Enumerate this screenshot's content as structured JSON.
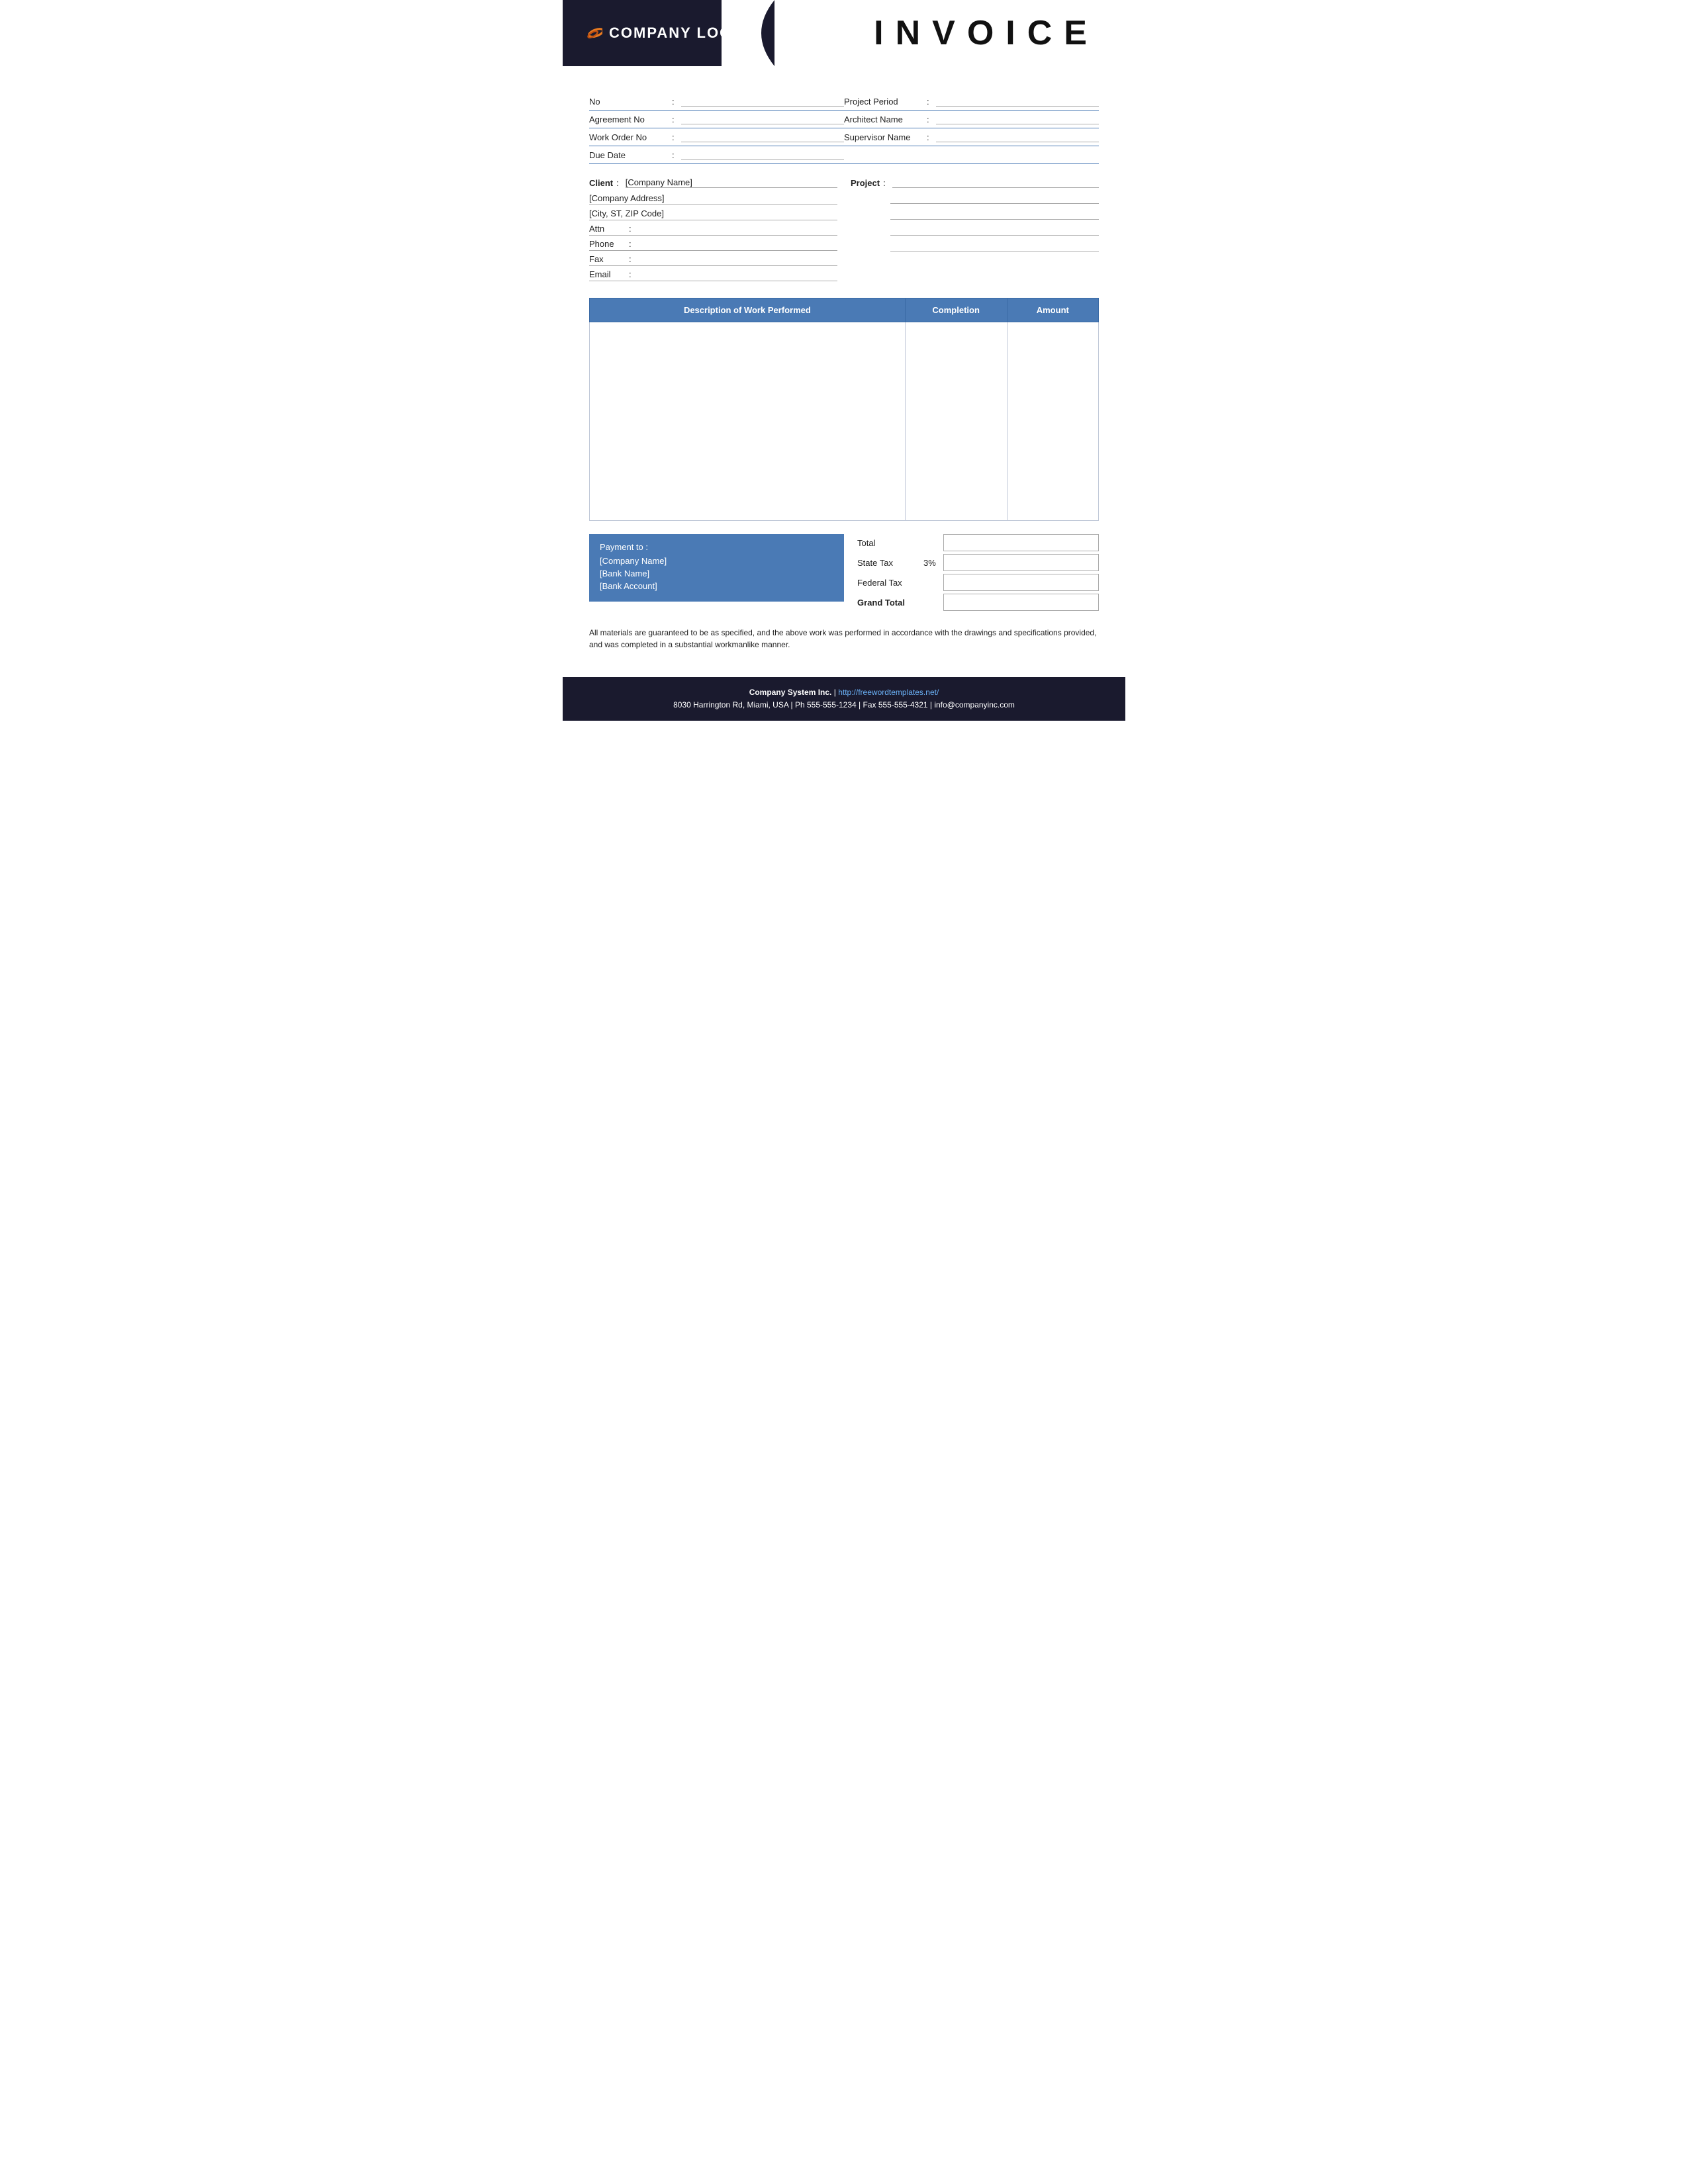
{
  "header": {
    "logo_text": "COMPANY LOGO",
    "invoice_title": "INVOICE"
  },
  "fields": {
    "rows": [
      {
        "left_label": "No",
        "left_colon": ":",
        "right_label": "Project Period",
        "right_colon": ":"
      },
      {
        "left_label": "Agreement No",
        "left_colon": ":",
        "right_label": "Architect Name",
        "right_colon": ":"
      },
      {
        "left_label": "Work Order No",
        "left_colon": ":",
        "right_label": "Supervisor Name",
        "right_colon": ":"
      },
      {
        "left_label": "Due Date",
        "left_colon": ":",
        "right_label": "",
        "right_colon": ""
      }
    ]
  },
  "client": {
    "label": "Client",
    "colon": ":",
    "name_placeholder": "[Company Name]",
    "address_placeholder": "[Company Address]",
    "city_placeholder": "[City, ST, ZIP Code]",
    "attn_label": "Attn",
    "attn_colon": ":",
    "phone_label": "Phone",
    "phone_colon": ":",
    "fax_label": "Fax",
    "fax_colon": ":",
    "email_label": "Email",
    "email_colon": ":"
  },
  "project": {
    "label": "Project",
    "colon": ":"
  },
  "table": {
    "headers": {
      "description": "Description of Work Performed",
      "completion": "Completion",
      "amount": "Amount"
    }
  },
  "payment": {
    "title": "Payment to :",
    "company": "[Company Name]",
    "bank": "[Bank Name]",
    "account": "[Bank Account]"
  },
  "totals": {
    "total_label": "Total",
    "state_tax_label": "State Tax",
    "state_tax_percent": "3%",
    "federal_tax_label": "Federal Tax",
    "grand_total_label": "Grand Total"
  },
  "footer_note": "All materials are guaranteed to be as specified, and the above work was performed in accordance with the drawings and specifications provided, and was completed in a substantial workmanlike manner.",
  "footer": {
    "company_name": "Company System Inc.",
    "separator": "|",
    "website_text": "http://freewordtemplates.net/",
    "address_line": "8030 Harrington Rd, Miami, USA | Ph 555-555-1234 | Fax 555-555-4321 | info@companyinc.com"
  }
}
